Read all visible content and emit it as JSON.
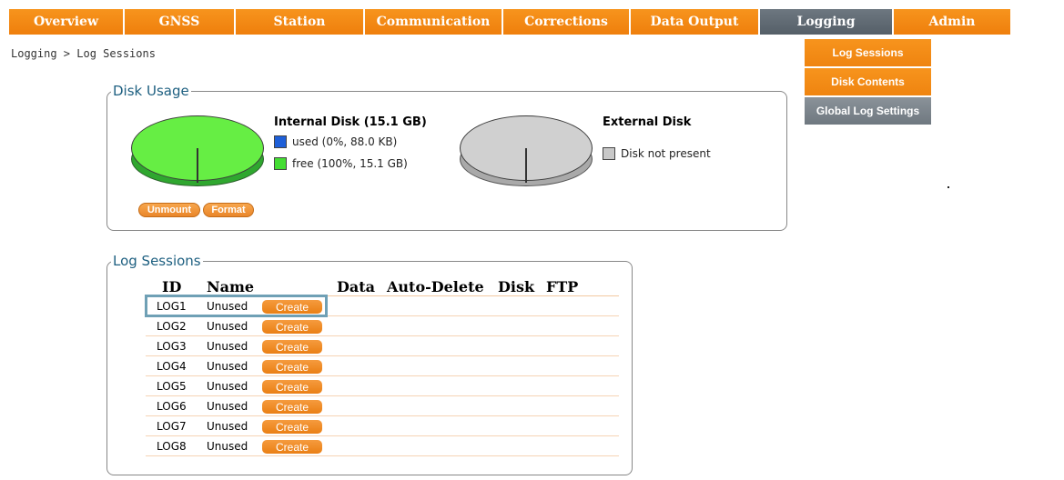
{
  "nav": {
    "tabs": [
      {
        "label": "Overview"
      },
      {
        "label": "GNSS"
      },
      {
        "label": "Station"
      },
      {
        "label": "Communication"
      },
      {
        "label": "Corrections"
      },
      {
        "label": "Data Output"
      },
      {
        "label": "Logging",
        "active": true
      },
      {
        "label": "Admin"
      }
    ],
    "dropdown": [
      "Log Sessions",
      "Disk Contents",
      "Global Log Settings"
    ]
  },
  "breadcrumb": "Logging > Log Sessions",
  "disk_usage": {
    "legend": "Disk Usage",
    "internal": {
      "title": "Internal Disk (15.1 GB)",
      "used": "used (0%, 88.0 KB)",
      "free": "free (100%, 15.1 GB)",
      "used_percent": 0,
      "buttons": {
        "unmount": "Unmount",
        "format": "Format"
      }
    },
    "external": {
      "title": "External Disk",
      "status": "Disk not present"
    }
  },
  "sessions": {
    "legend": "Log Sessions",
    "columns": [
      "ID",
      "Name",
      "Data",
      "Auto-Delete",
      "Disk",
      "FTP"
    ],
    "rows": [
      {
        "id": "LOG1",
        "name": "Unused",
        "action": "Create"
      },
      {
        "id": "LOG2",
        "name": "Unused",
        "action": "Create"
      },
      {
        "id": "LOG3",
        "name": "Unused",
        "action": "Create"
      },
      {
        "id": "LOG4",
        "name": "Unused",
        "action": "Create"
      },
      {
        "id": "LOG5",
        "name": "Unused",
        "action": "Create"
      },
      {
        "id": "LOG6",
        "name": "Unused",
        "action": "Create"
      },
      {
        "id": "LOG7",
        "name": "Unused",
        "action": "Create"
      },
      {
        "id": "LOG8",
        "name": "Unused",
        "action": "Create"
      }
    ]
  },
  "colors": {
    "nav_orange": "#f7941d",
    "nav_active": "#5f6972",
    "used": "#1e5fd8",
    "free": "#44dd33",
    "not_present": "#c8c8c8",
    "legend_text": "#1d5f80",
    "highlight": "#6fa0b5"
  }
}
